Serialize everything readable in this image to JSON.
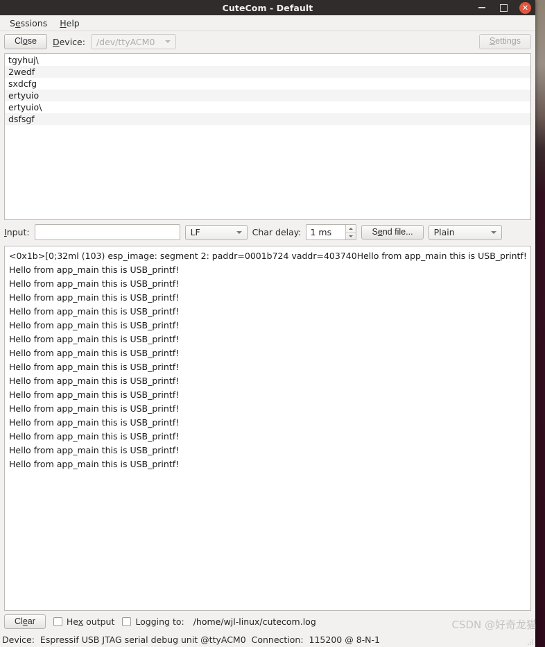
{
  "window": {
    "title": "CuteCom - Default",
    "controls": {
      "minimize": "–",
      "maximize": "□",
      "close": "✕"
    }
  },
  "menubar": {
    "items": [
      {
        "label": "Sessions",
        "mnemonic": "e"
      },
      {
        "label": "Help",
        "mnemonic": "H"
      }
    ]
  },
  "toolbar": {
    "close_button": "Close",
    "close_mnemonic": "o",
    "device_label": "Device:",
    "device_mnemonic": "D",
    "device_value": "/dev/ttyACM0",
    "settings_button": "Settings",
    "settings_mnemonic": "S"
  },
  "history": {
    "lines": [
      "tgyhuj\\",
      "2wedf",
      "sxdcfg",
      "ertyuio",
      "ertyuio\\",
      "dsfsgf"
    ]
  },
  "input_row": {
    "input_label": "Input:",
    "input_mnemonic": "I",
    "input_value": "",
    "input_placeholder": "",
    "line_ending": "LF",
    "char_delay_label": "Char delay:",
    "char_delay_value": "1 ms",
    "send_file_button": "Send file...",
    "send_file_mnemonic": "e",
    "format": "Plain"
  },
  "output": {
    "lines": [
      "<0x1b>[0;32ml (103) esp_image: segment 2: paddr=0001b724 vaddr=403740Hello from app_main this is USB_printf!",
      "Hello from app_main this is USB_printf!",
      "Hello from app_main this is USB_printf!",
      "Hello from app_main this is USB_printf!",
      "Hello from app_main this is USB_printf!",
      "Hello from app_main this is USB_printf!",
      "Hello from app_main this is USB_printf!",
      "Hello from app_main this is USB_printf!",
      "Hello from app_main this is USB_printf!",
      "Hello from app_main this is USB_printf!",
      "Hello from app_main this is USB_printf!",
      "Hello from app_main this is USB_printf!",
      "Hello from app_main this is USB_printf!",
      "Hello from app_main this is USB_printf!",
      "Hello from app_main this is USB_printf!",
      "Hello from app_main this is USB_printf!"
    ]
  },
  "bottom_bar": {
    "clear_button": "Clear",
    "clear_mnemonic": "e",
    "hex_output_label": "Hex output",
    "hex_output_mnemonic": "x",
    "hex_output_checked": false,
    "logging_label": "Logging to:",
    "logging_checked": false,
    "log_path": "/home/wjl-linux/cutecom.log"
  },
  "statusbar": {
    "device_label": "Device:",
    "device_value": "Espressif USB JTAG serial debug unit @ttyACM0",
    "connection_label": "Connection:",
    "connection_value": "115200 @ 8-N-1"
  },
  "watermark": {
    "text": "CSDN @好奇龙猫"
  },
  "colors": {
    "titlebar_bg": "#2f2c2b",
    "close_button_bg": "#e2563c",
    "window_bg": "#f2f1f0",
    "field_bg": "#ffffff",
    "desktop_bg": "#2e0b1a"
  }
}
